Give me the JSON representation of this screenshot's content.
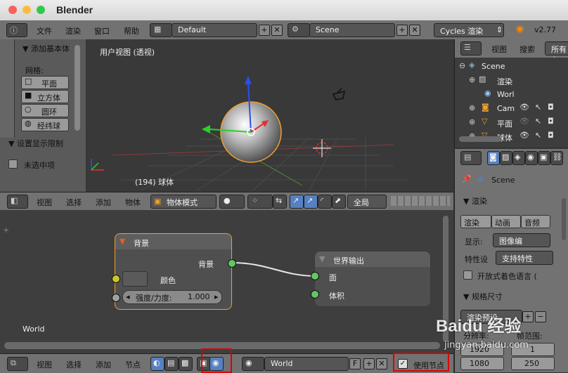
{
  "window": {
    "title": "Blender"
  },
  "info_bar": {
    "menus": [
      "文件",
      "渲染",
      "窗口",
      "帮助"
    ],
    "layout": "Default",
    "scene": "Scene",
    "engine": "Cycles 渲染",
    "version": "v2.77"
  },
  "tool_shelf": {
    "add_primitive_header": "▼ 添加基本体",
    "mesh_label": "网格:",
    "items": [
      "平面",
      "立方体",
      "圆环",
      "经纬球"
    ],
    "display_limit_header": "▼ 设置显示限制",
    "unselected_label": "未选中项"
  },
  "viewport": {
    "view_name": "用户视图 (透视)",
    "object_label": "(194) 球体"
  },
  "viewport_header": {
    "menus": [
      "视图",
      "选择",
      "添加",
      "物体"
    ],
    "mode": "物体模式",
    "global": "全局"
  },
  "node_editor": {
    "background_node": {
      "title": "背景",
      "output": "背景",
      "color_label": "颜色",
      "strength_label": "强度/力度:",
      "strength_value": "1.000"
    },
    "output_node": {
      "title": "世界输出",
      "inputs": [
        "面",
        "体积"
      ]
    },
    "world_label": "World"
  },
  "node_header": {
    "menus": [
      "视图",
      "选择",
      "添加",
      "节点"
    ],
    "world": "World",
    "fake_user": "F",
    "use_nodes": "使用节点"
  },
  "outliner": {
    "menus": [
      "视图",
      "搜索"
    ],
    "filter": "所有有",
    "items": [
      {
        "label": "Scene",
        "level": 0
      },
      {
        "label": "渲染",
        "level": 1
      },
      {
        "label": "Worl",
        "level": 1
      },
      {
        "label": "Cam",
        "level": 1
      },
      {
        "label": "平面",
        "level": 1
      },
      {
        "label": "球体",
        "level": 1
      }
    ]
  },
  "properties": {
    "scene": "Scene",
    "render_header": "▼ 渲染",
    "render_btn": "渲染",
    "anim_btn": "动画",
    "audio_btn": "音频",
    "display_label": "显示:",
    "display_value": "图像编",
    "feature_label": "特性设",
    "feature_value": "支持特性",
    "osl_label": "开放式着色语言 (",
    "dimensions_header": "▼ 规格尺寸",
    "preset": "渲染预设",
    "res_label": "分辨率:",
    "res_x": "1920",
    "res_y": "1080",
    "frame_label": "帧范围:",
    "frame_start": "1",
    "frame_end": "250"
  },
  "watermark": {
    "text": "Baidu 经验",
    "url": "jingyan.baidu.com"
  }
}
